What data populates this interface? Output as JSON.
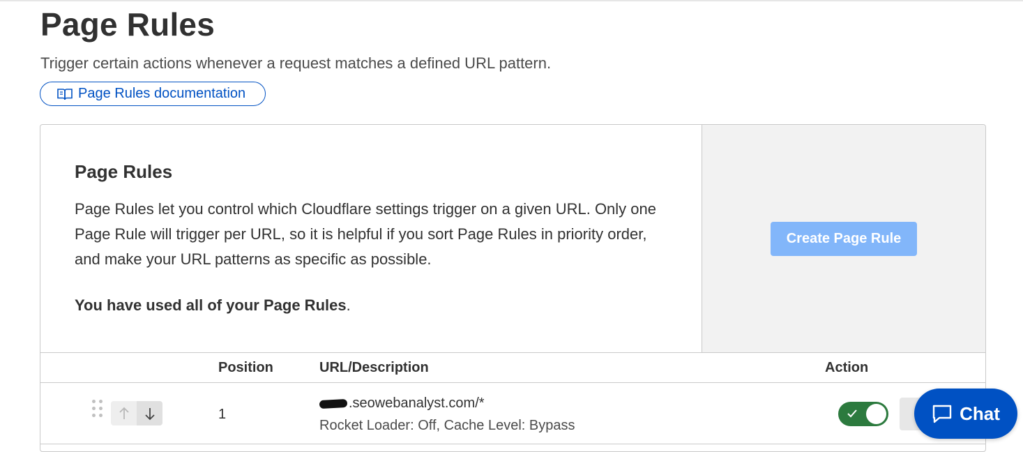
{
  "page": {
    "title": "Page Rules",
    "subtitle": "Trigger certain actions whenever a request matches a defined URL pattern.",
    "doc_link_label": "Page Rules documentation"
  },
  "card": {
    "heading": "Page Rules",
    "description": "Page Rules let you control which Cloudflare settings trigger on a given URL. Only one Page Rule will trigger per URL, so it is helpful if you sort Page Rules in priority order, and make your URL patterns as specific as possible.",
    "warning_bold": "You have used all of your Page Rules",
    "warning_end": ".",
    "create_button_label": "Create Page Rule"
  },
  "table": {
    "columns": [
      "Position",
      "URL/Description",
      "Action"
    ],
    "rows": [
      {
        "position": "1",
        "url": ".seowebanalyst.com/*",
        "settings": "Rocket Loader: Off, Cache Level: Bypass",
        "enabled": true
      }
    ]
  },
  "chat": {
    "label": "Chat"
  },
  "colors": {
    "accent": "#0051c3",
    "create_button": "#82b6fa",
    "toggle_on": "#2c7a3e"
  },
  "icons": {
    "doc_link": "book-icon",
    "drag": "drag-handle-icon",
    "up": "arrow-up-icon",
    "down": "arrow-down-icon",
    "toggle": "check-icon",
    "chat": "chat-bubble-icon"
  }
}
